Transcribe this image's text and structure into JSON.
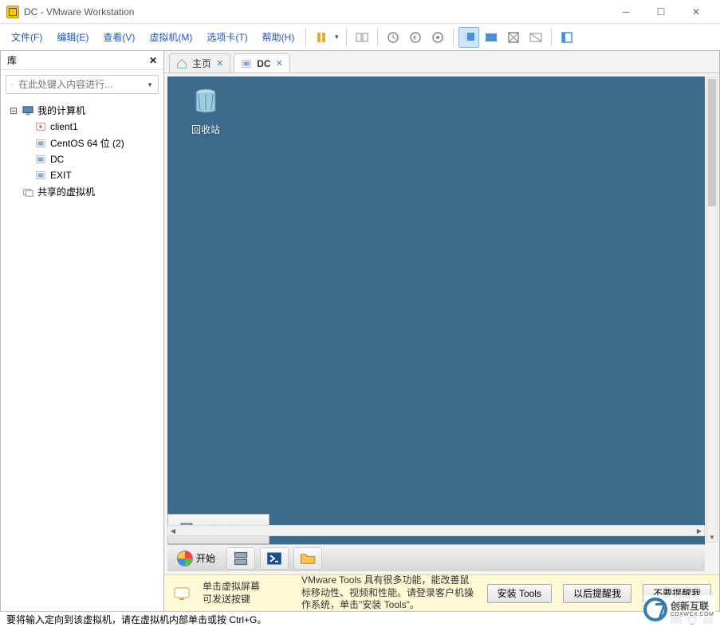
{
  "window": {
    "title": "DC - VMware Workstation"
  },
  "menus": {
    "file": "文件(F)",
    "edit": "编辑(E)",
    "view": "查看(V)",
    "vm": "虚拟机(M)",
    "tabs": "选项卡(T)",
    "help": "帮助(H)"
  },
  "sidebar": {
    "header": "库",
    "search_placeholder": "在此处键入内容进行...",
    "root": "我的计算机",
    "items": [
      {
        "label": "client1"
      },
      {
        "label": "CentOS 64 位 (2)"
      },
      {
        "label": "DC"
      },
      {
        "label": "EXIT"
      }
    ],
    "shared": "共享的虚拟机"
  },
  "tabs": {
    "home": "主页",
    "active": "DC"
  },
  "guest": {
    "recycle_bin": "回收站",
    "server_manager": "服务器管理器",
    "start": "开始"
  },
  "hint": {
    "line1": "单击虚拟屏幕",
    "line2": "可发送按键",
    "msg": "VMware Tools 具有很多功能，能改善鼠标移动性、视频和性能。请登录客户机操作系统，单击\"安装 Tools\"。",
    "install": "安装 Tools",
    "later": "以后提醒我",
    "never": "不要提醒我"
  },
  "status": {
    "text": "要将输入定向到该虚拟机，请在虚拟机内部单击或按 Ctrl+G。"
  },
  "watermark": {
    "line1": "创新互联",
    "line2": "CDXWCX.COM"
  }
}
